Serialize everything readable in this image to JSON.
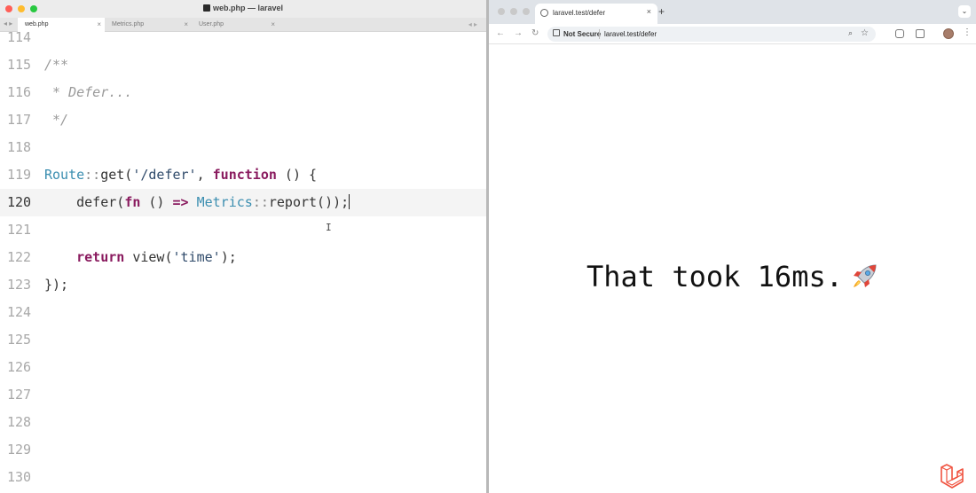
{
  "editor": {
    "window_title": "web.php — laravel",
    "tabs": [
      {
        "label": "web.php",
        "active": true
      },
      {
        "label": "Metrics.php",
        "active": false
      },
      {
        "label": "User.php",
        "active": false
      }
    ],
    "close_glyph": "×",
    "tab_nav_glyph": "◂ ▸",
    "lines": [
      {
        "num": "114",
        "code": ""
      },
      {
        "num": "115",
        "code": "/**"
      },
      {
        "num": "116",
        "code": " * Defer..."
      },
      {
        "num": "117",
        "code": " */"
      },
      {
        "num": "118",
        "code": ""
      },
      {
        "num": "119",
        "code": "Route::get('/defer', function () {"
      },
      {
        "num": "120",
        "code": "    defer(fn () => Metrics::report());"
      },
      {
        "num": "121",
        "code": ""
      },
      {
        "num": "122",
        "code": "    return view('time');"
      },
      {
        "num": "123",
        "code": "});"
      },
      {
        "num": "124",
        "code": ""
      },
      {
        "num": "125",
        "code": ""
      },
      {
        "num": "126",
        "code": ""
      },
      {
        "num": "127",
        "code": ""
      },
      {
        "num": "128",
        "code": ""
      },
      {
        "num": "129",
        "code": ""
      },
      {
        "num": "130",
        "code": ""
      }
    ],
    "current_line": "120",
    "cursor_glyph": "I"
  },
  "browser": {
    "tab_title": "laravel.test/defer",
    "new_tab": "+",
    "security_label": "Not Secure",
    "url": "laravel.test/defer",
    "nav": {
      "back": "←",
      "forward": "→",
      "reload": "↻"
    },
    "page_text": "That took 16ms.",
    "icons": [
      "globe-icon",
      "warning-icon",
      "zoom-icon",
      "star-icon",
      "extension-icon",
      "profile-avatar",
      "laravel-logo",
      "rocket-emoji"
    ]
  },
  "colors": {
    "traffic_red": "#ff5f57",
    "traffic_yellow": "#febc2e",
    "traffic_green": "#28c840",
    "keyword": "#8a1b5f",
    "class": "#3b8eb0",
    "laravel": "#f05340"
  }
}
